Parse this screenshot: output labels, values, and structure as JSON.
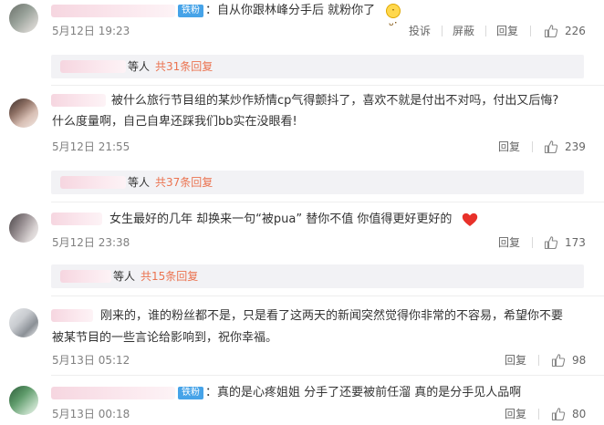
{
  "icons": {
    "like": "thumbs-up-icon",
    "heart": "red-heart-icon",
    "face": "cute-face-emoji"
  },
  "colors": {
    "badge": "#46a3e8",
    "reply_count": "#eb7350",
    "reply_bg": "#f2f2f5"
  },
  "comments": [
    {
      "badge": "铁粉",
      "text_lines": [
        "：自从你跟林峰分手后 就粉你了"
      ],
      "time": "5月12日 19:23",
      "actions": {
        "report": "投诉",
        "block": "屏蔽",
        "reply": "回复"
      },
      "likes": "226",
      "replies": {
        "who": "等人",
        "count": "共31条回复"
      }
    },
    {
      "text_lines": [
        "被什么旅行节目组的某炒作矫情cp气得颤抖了，喜欢不就是付出不对吗，付出又后悔?",
        "什么度量啊，自己自卑还踩我们bb实在没眼看!"
      ],
      "time": "5月12日 21:55",
      "actions": {
        "reply": "回复"
      },
      "likes": "239",
      "replies": {
        "who": "等人",
        "count": "共37条回复"
      }
    },
    {
      "text_lines": [
        "女生最好的几年  却换来一句“被pua” 替你不值 你值得更好更好的"
      ],
      "time": "5月12日 23:38",
      "actions": {
        "reply": "回复"
      },
      "likes": "173",
      "replies": {
        "who": "等人",
        "count": "共15条回复"
      }
    },
    {
      "text_lines": [
        "刚来的，谁的粉丝都不是，只是看了这两天的新闻突然觉得你非常的不容易，希望你不要",
        "被某节目的一些言论给影响到，祝你幸福。"
      ],
      "time": "5月13日 05:12",
      "actions": {
        "reply": "回复"
      },
      "likes": "98"
    },
    {
      "badge": "铁粉",
      "text_lines": [
        "：真的是心疼姐姐 分手了还要被前任溜 真的是分手见人品啊"
      ],
      "time": "5月13日 00:18",
      "actions": {
        "reply": "回复"
      },
      "likes": "80"
    }
  ]
}
